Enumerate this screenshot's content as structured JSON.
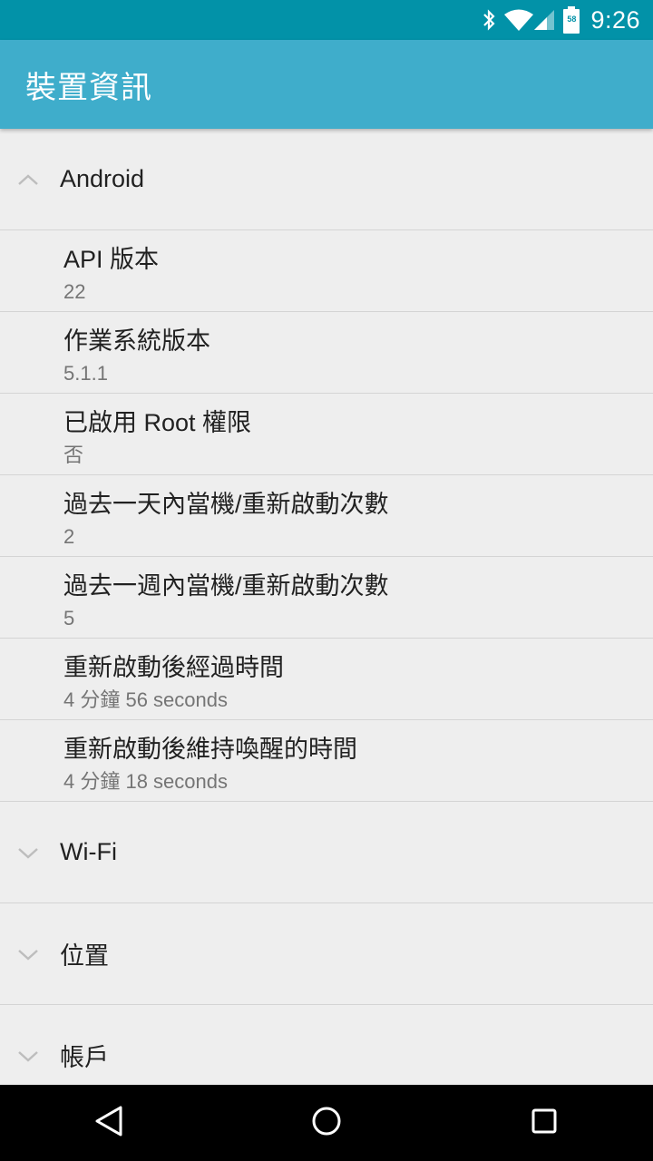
{
  "status_bar": {
    "time": "9:26",
    "battery_level": "58",
    "icons": [
      "bluetooth-icon",
      "wifi-icon",
      "cellular-signal-icon",
      "battery-icon"
    ]
  },
  "app_bar": {
    "title": "裝置資訊",
    "color": "#3fadcb"
  },
  "sections": [
    {
      "label": "Android",
      "expanded": true,
      "items": [
        {
          "name": "API 版本",
          "value": "22"
        },
        {
          "name": "作業系統版本",
          "value": "5.1.1"
        },
        {
          "name": "已啟用 Root 權限",
          "value": "否"
        },
        {
          "name": "過去一天內當機/重新啟動次數",
          "value": "2"
        },
        {
          "name": "過去一週內當機/重新啟動次數",
          "value": "5"
        },
        {
          "name": "重新啟動後經過時間",
          "value": "4 分鐘 56 seconds"
        },
        {
          "name": "重新啟動後維持喚醒的時間",
          "value": "4 分鐘 18 seconds"
        }
      ]
    },
    {
      "label": "Wi-Fi",
      "expanded": false
    },
    {
      "label": "位置",
      "expanded": false
    },
    {
      "label": "帳戶",
      "expanded": false
    }
  ],
  "nav_bar": {
    "buttons": [
      "back-icon",
      "home-icon",
      "recents-icon"
    ]
  }
}
